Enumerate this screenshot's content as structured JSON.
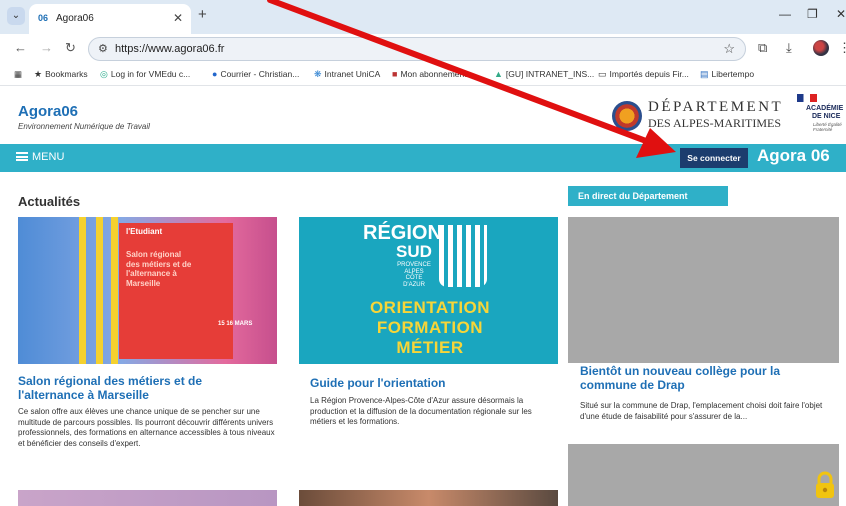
{
  "browser": {
    "tab_favicon": "06",
    "tab_title": "Agora06",
    "url": "https://www.agora06.fr",
    "bookmarks": [
      {
        "icon": "★",
        "label": "Bookmarks"
      },
      {
        "icon": "◎",
        "label": "Log in for VMEdu c..."
      },
      {
        "icon": "●",
        "label": "Courrier - Christian..."
      },
      {
        "icon": "❋",
        "label": "Intranet UniCA"
      },
      {
        "icon": "■",
        "label": "Mon abonnement"
      },
      {
        "icon": "▲",
        "label": "[GU] INTRANET_INS..."
      },
      {
        "icon": "▭",
        "label": "Importés depuis Fir..."
      },
      {
        "icon": "▤",
        "label": "Libertempo"
      }
    ]
  },
  "header": {
    "brand_title": "Agora06",
    "brand_subtitle": "Environnement Numérique de Travail",
    "dept_line1": "DÉPARTEMENT",
    "dept_line2": "DES ALPES-MARITIMES",
    "academie_line1": "ACADÉMIE",
    "academie_line2": "DE NICE",
    "academie_motto": "Liberté Égalité Fraternité"
  },
  "navbar": {
    "menu_label": "MENU",
    "login_label": "Se connecter",
    "brand": "Agora 06"
  },
  "news": {
    "section_title": "Actualités",
    "cards": [
      {
        "title": "Salon régional des métiers et de l'alternance à Marseille",
        "text": "Ce salon offre aux élèves une chance unique de se pencher sur une multitude de parcours possibles. Ils pourront découvrir différents univers professionnels, des formations en alternance accessibles à tous niveaux et bénéficier des conseils d'expert.",
        "image_text": {
          "brand": "l'Etudiant",
          "poster": "Salon régional des métiers et de l'alternance à Marseille",
          "dates": "15 16 MARS"
        }
      },
      {
        "title": "Guide pour l'orientation",
        "text": "La Région Provence-Alpes-Côte d'Azur assure désormais la production et la diffusion de la documentation régionale sur les métiers et les formations.",
        "image_text": {
          "line1": "RÉGION",
          "line2": "SUD",
          "line3": "PROVENCE ALPES CÔTE D'AZUR",
          "orientation": "ORIENTATION FORMATION MÉTIER"
        }
      }
    ]
  },
  "department": {
    "badge": "En direct du Département",
    "card_title": "Bientôt un nouveau collège pour la commune de Drap",
    "card_text": "Situé sur la commune de Drap, l'emplacement choisi doit faire l'objet d'une étude de faisabilité pour s'assurer de la..."
  },
  "colors": {
    "accent_teal": "#2fb0c8",
    "brand_blue": "#1e6fb5",
    "login_navy": "#1c3d6e",
    "annotation_arrow": "#e01010"
  }
}
